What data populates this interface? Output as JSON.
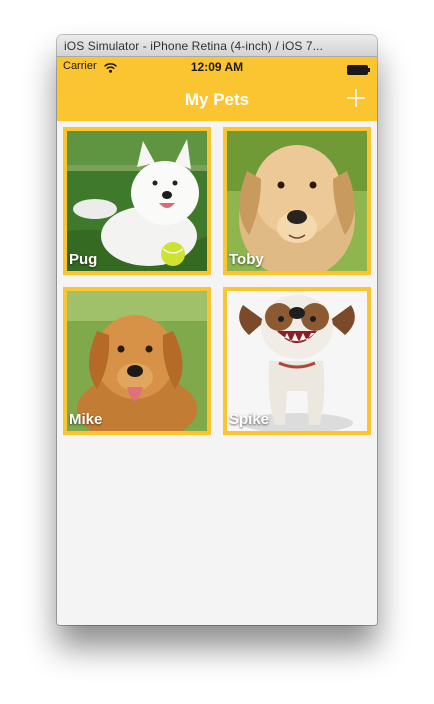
{
  "window": {
    "title": "iOS Simulator - iPhone Retina (4-inch) / iOS 7..."
  },
  "status_bar": {
    "carrier": "Carrier",
    "time": "12:09 AM",
    "icons": [
      "wifi-icon",
      "battery-icon"
    ]
  },
  "nav_bar": {
    "title": "My Pets",
    "add_icon": "plus-icon"
  },
  "theme": {
    "accent": "#fbc531",
    "background": "#f4f4f4"
  },
  "pets": [
    {
      "name": "Pug"
    },
    {
      "name": "Toby"
    },
    {
      "name": "Mike"
    },
    {
      "name": "Spike"
    }
  ]
}
